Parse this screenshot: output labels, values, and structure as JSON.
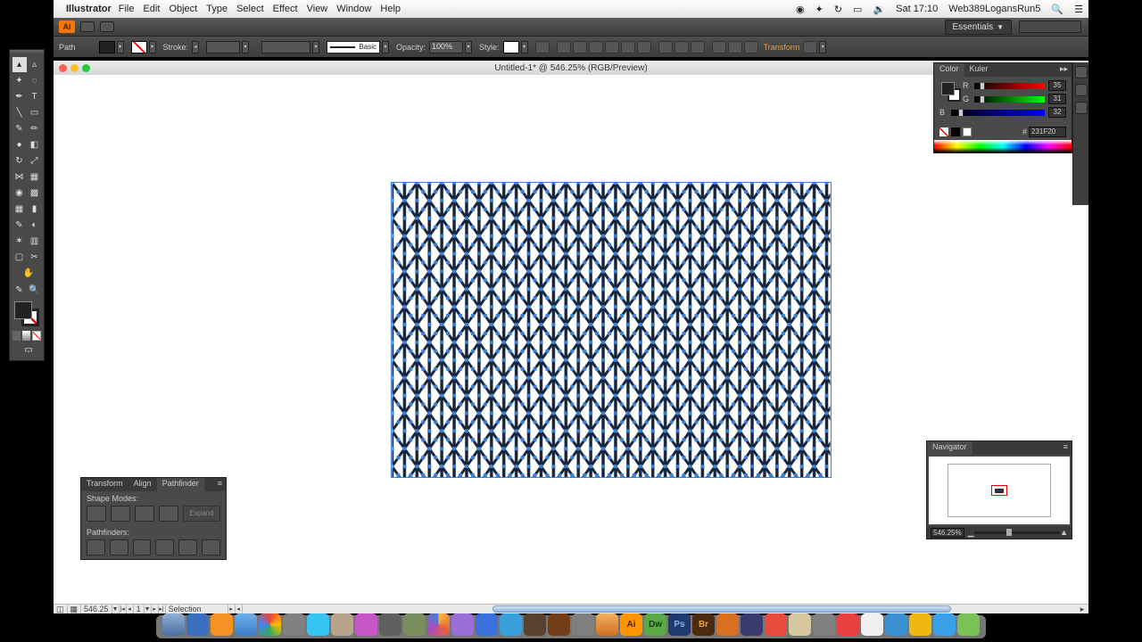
{
  "menubar": {
    "app": "Illustrator",
    "items": [
      "File",
      "Edit",
      "Object",
      "Type",
      "Select",
      "Effect",
      "View",
      "Window",
      "Help"
    ],
    "clock": "Sat 17:10",
    "user": "Web389LogansRun5"
  },
  "workspace": {
    "label": "Essentials"
  },
  "control": {
    "selection_label": "Path",
    "stroke_label": "Stroke:",
    "opacity_label": "Opacity:",
    "opacity_value": "100%",
    "style_label": "Style:",
    "basic_label": "Basic",
    "transform_label": "Transform"
  },
  "document": {
    "title": "Untitled-1* @ 546.25% (RGB/Preview)"
  },
  "color_panel": {
    "tab_color": "Color",
    "tab_kuler": "Kuler",
    "r_label": "R",
    "r_value": "35",
    "g_label": "G",
    "g_value": "31",
    "b_label": "B",
    "b_value": "32",
    "hex": "231F20"
  },
  "navigator": {
    "tab": "Navigator",
    "zoom": "546.25%"
  },
  "pathfinder": {
    "tab_transform": "Transform",
    "tab_align": "Align",
    "tab_pathfinder": "Pathfinder",
    "shape_modes": "Shape Modes:",
    "expand": "Expand",
    "pathfinders": "Pathfinders:"
  },
  "status": {
    "zoom": "546.25",
    "artboard": "1",
    "tool": "Selection"
  },
  "dock_colors": [
    "#5e91c7",
    "#3a6fbd",
    "#f39323",
    "#f1c40f",
    "#7fbf60",
    "#9b59b6",
    "#3aa0dc",
    "#b8a48a",
    "#c856c8",
    "#606060",
    "#7b8e5d",
    "#55c1d4",
    "#9a6fd8",
    "#3a6fdc",
    "#8a9bdc",
    "#733e17",
    "#d8a040",
    "#4a4a4a",
    "#765e46",
    "#ff9500",
    "#5ca845",
    "#018fe1",
    "#8c6239",
    "#31a8e0",
    "#ff7e00",
    "#e64c3c",
    "#0fa93b",
    "#0e76a8",
    "#6d5030",
    "#efb810",
    "#f39c12",
    "#78c257",
    "#3-placeholder"
  ]
}
